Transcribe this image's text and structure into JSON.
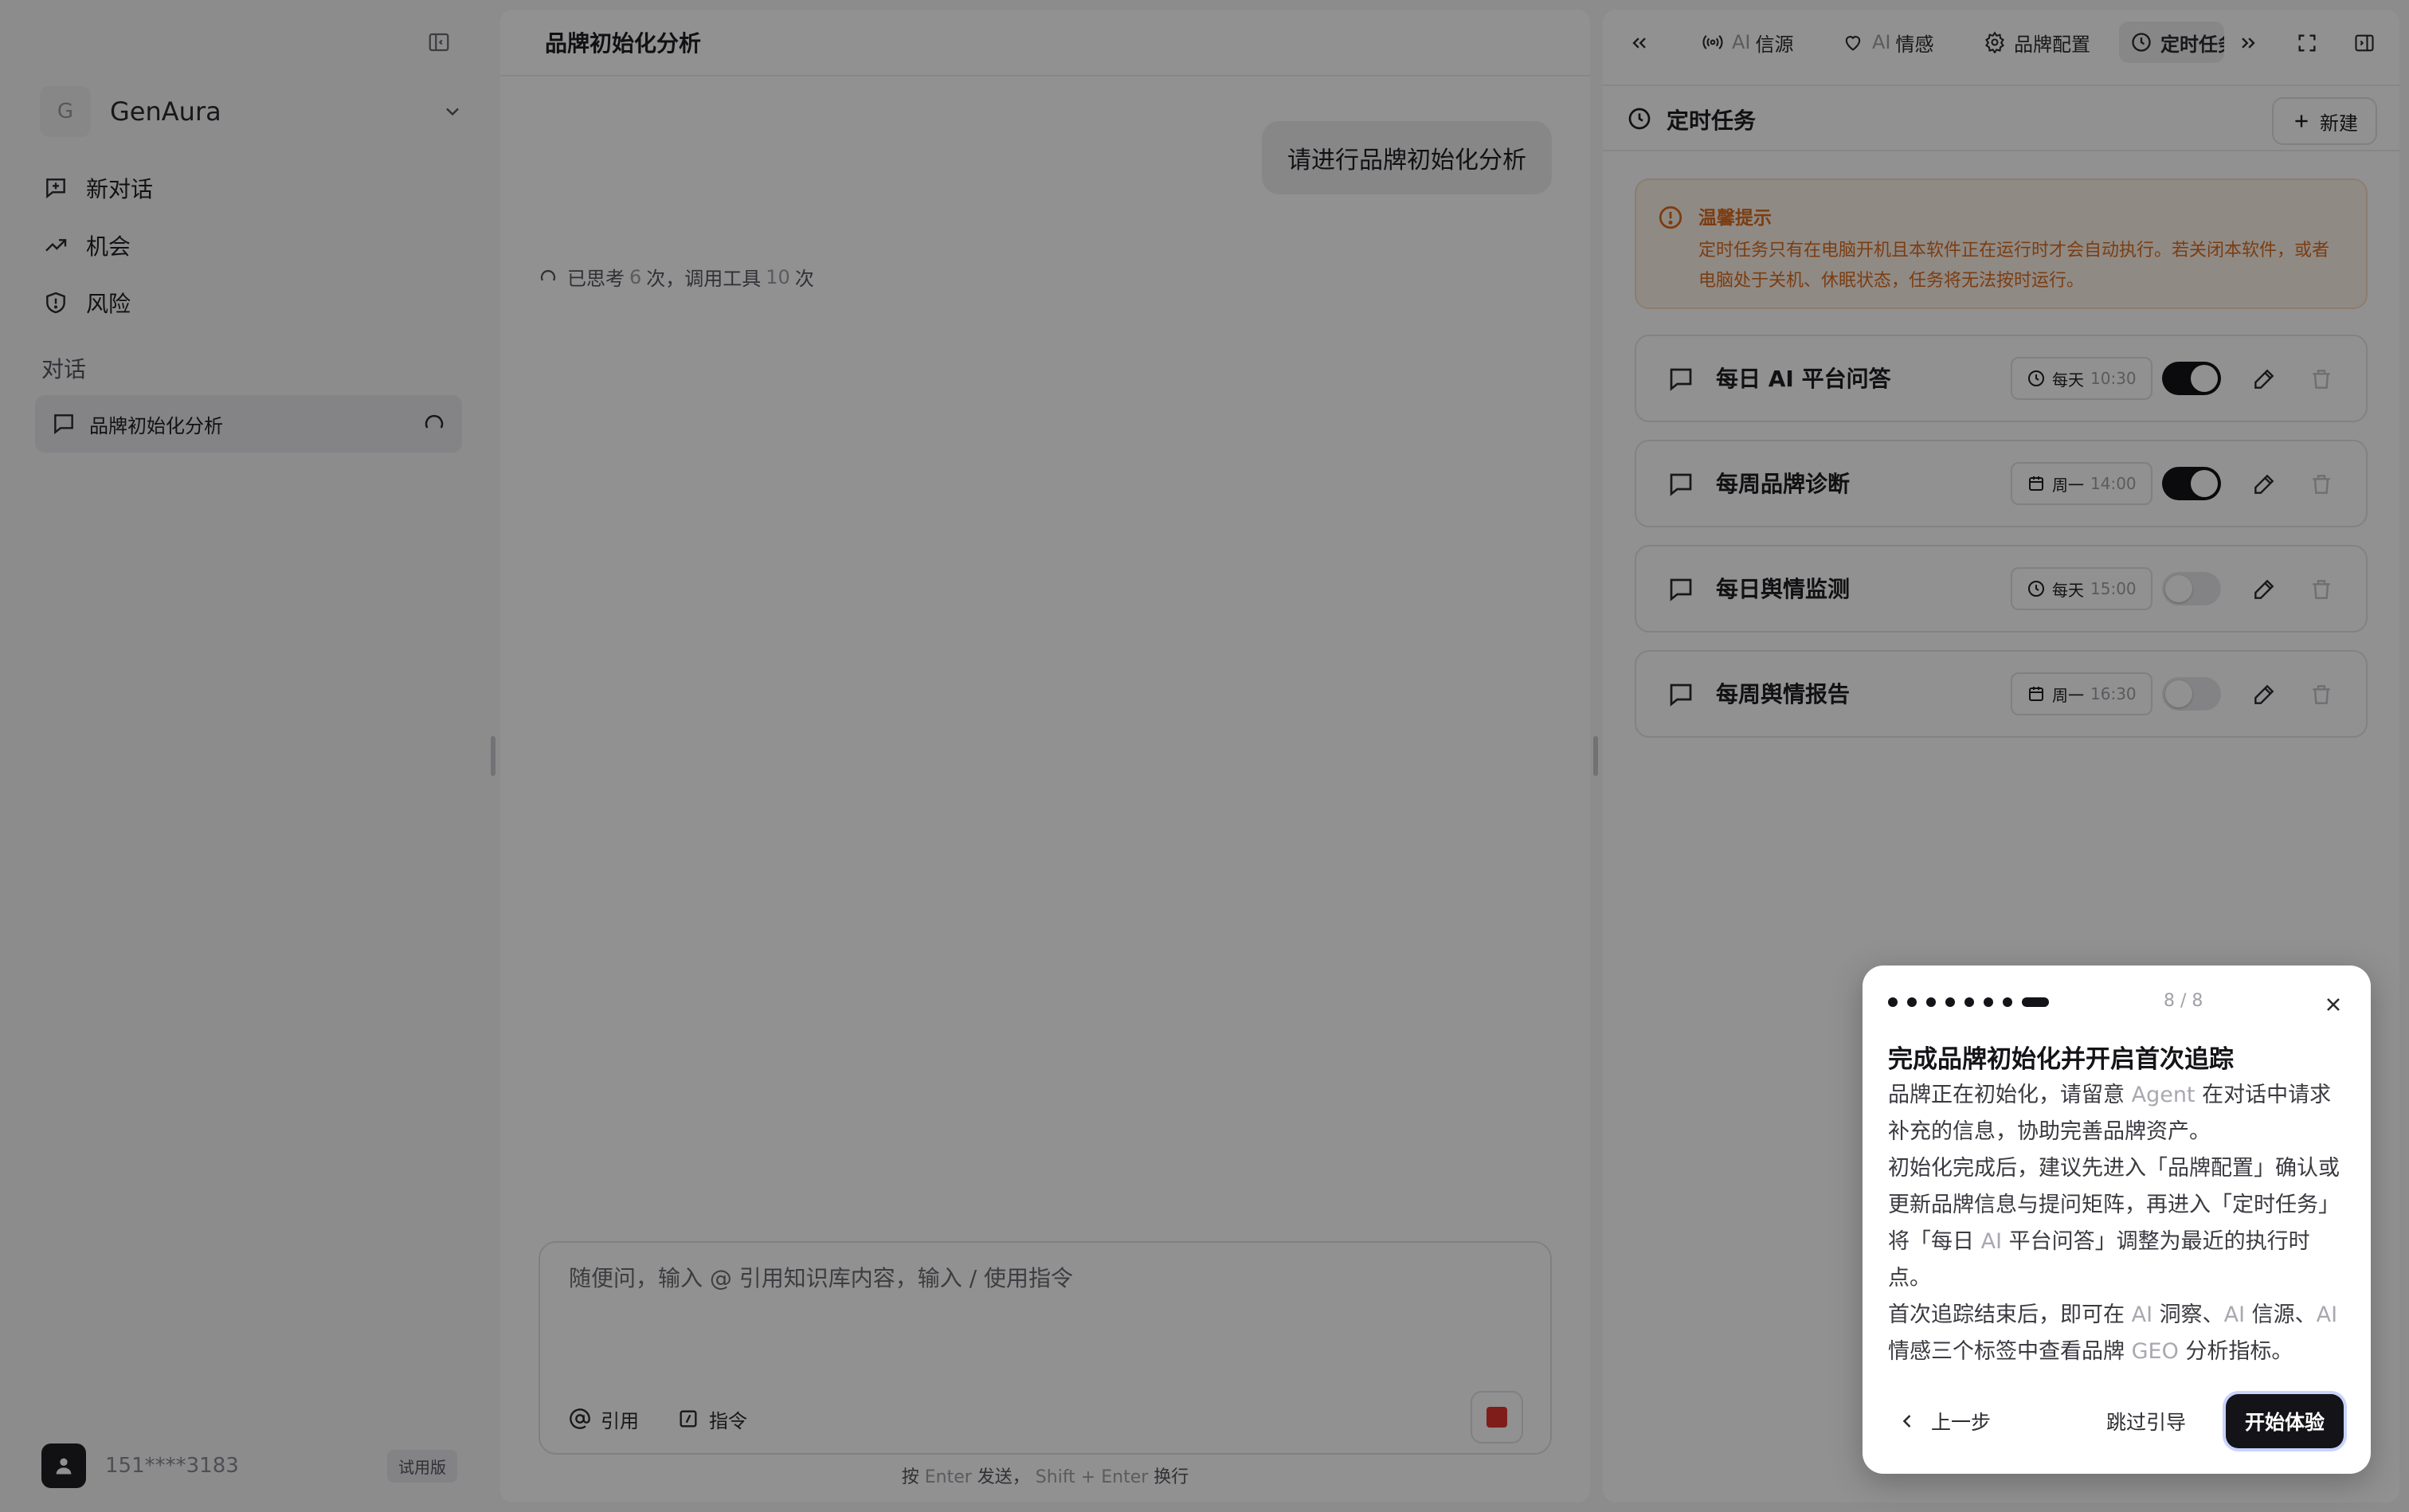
{
  "sidebar": {
    "workspace_initial": "G",
    "workspace_name": "GenAura",
    "nav": [
      {
        "label": "新对话",
        "icon": "message-plus-icon"
      },
      {
        "label": "机会",
        "icon": "trending-up-icon"
      },
      {
        "label": "风险",
        "icon": "shield-icon"
      }
    ],
    "section_label": "对话",
    "conversations": [
      {
        "title": "品牌初始化分析",
        "status": "loading"
      }
    ],
    "user": {
      "phone": "151****3183",
      "badge": "试用版"
    }
  },
  "chat": {
    "title": "品牌初始化分析",
    "user_message": "请进行品牌初始化分析",
    "thinking": {
      "prefix": "已思考",
      "think_count": "6",
      "mid": "次，调用工具",
      "tool_count": "10",
      "suffix": "次"
    },
    "composer": {
      "placeholder": "随便问，输入 @ 引用知识库内容，输入 / 使用指令",
      "value": "",
      "cite_label": "引用",
      "command_label": "指令"
    },
    "hint": {
      "p1": "按",
      "k1": "Enter",
      "p2": "发送，",
      "k2": "Shift + Enter",
      "p3": "换行"
    }
  },
  "panel": {
    "tabs": [
      {
        "dim": "AI",
        "label": "信源",
        "icon": "broadcast-icon"
      },
      {
        "dim": "AI",
        "label": "情感",
        "icon": "heart-icon"
      },
      {
        "dim": "",
        "label": "品牌配置",
        "icon": "gear-icon"
      },
      {
        "dim": "",
        "label": "定时任务",
        "icon": "clock-icon",
        "active": true
      }
    ],
    "section_title": "定时任务",
    "new_label": "新建",
    "notice": {
      "title": "温馨提示",
      "text": "定时任务只有在电脑开机且本软件正在运行时才会自动执行。若关闭本软件，或者电脑处于关机、休眠状态，任务将无法按时运行。"
    },
    "tasks": [
      {
        "name": "每日 AI 平台问答",
        "freq": "每天",
        "time": "10:30",
        "enabled": true,
        "icon": "clock-icon"
      },
      {
        "name": "每周品牌诊断",
        "freq": "周一",
        "time": "14:00",
        "enabled": true,
        "icon": "calendar-icon"
      },
      {
        "name": "每日舆情监测",
        "freq": "每天",
        "time": "15:00",
        "enabled": false,
        "icon": "clock-icon"
      },
      {
        "name": "每周舆情报告",
        "freq": "周一",
        "time": "16:30",
        "enabled": false,
        "icon": "calendar-icon"
      }
    ]
  },
  "tour": {
    "total_dots": 8,
    "current_dot": 8,
    "step_text": "8 / 8",
    "title": "完成品牌初始化并开启首次追踪",
    "para1_a": "品牌正在初始化，请留意 ",
    "para1_dim": "Agent",
    "para1_b": " 在对话中请求补充的信息，协助完善品牌资产。",
    "para2_a": "初始化完成后，建议先进入「品牌配置」确认或更新品牌信息与提问矩阵，再进入「定时任务」将「每日 ",
    "para2_dim": "AI",
    "para2_b": " 平台问答」调整为最近的执行时点。",
    "para3_a": "首次追踪结束后，即可在 ",
    "para3_dim1": "AI",
    "para3_b": " 洞察、",
    "para3_dim2": "AI",
    "para3_c": " 信源、",
    "para3_dim3": "AI",
    "para3_d": " 情感三个标签中查看品牌 ",
    "para3_dim4": "GEO",
    "para3_e": " 分析指标。",
    "prev_label": "上一步",
    "skip_label": "跳过引导",
    "start_label": "开始体验"
  }
}
